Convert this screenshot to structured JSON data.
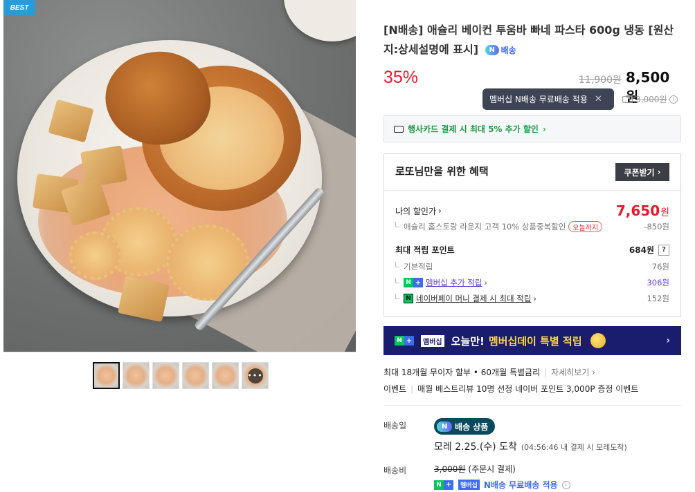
{
  "gallery": {
    "badge": "BEST",
    "thumb_more": "•••"
  },
  "product": {
    "title": "[N배송] 애슐리 베이컨 투움바 빠네 파스타 600g 냉동 [원산지:상세설명에 표시]",
    "npay_delivery_label": "배송",
    "discount_rate": "35%",
    "original_price": "11,900원",
    "sale_price": "8,500원"
  },
  "shipping_tooltip": {
    "text": "멤버십 N배송 무료배송 적용",
    "close": "✕"
  },
  "shipping_fee_row": {
    "fee": "3,000원",
    "info": "i"
  },
  "card_promo": {
    "text": "행사카드 결제 시 최대 5% 추가 할인",
    "arrow": "›"
  },
  "benefit": {
    "header": "로또님만을 위한 혜택",
    "coupon_button": "쿠폰받기",
    "coupon_arrow": "›",
    "my_discount_label": "나의 할인가",
    "my_discount_arrow": "›",
    "my_discount_value": "7,650",
    "my_discount_unit": "원",
    "discount_detail": "애슐리 홈스토랑 라운지 고객 10% 상품중복할인",
    "discount_detail_badge": "오늘까지",
    "discount_detail_value": "-850원",
    "points_label": "최대 적립 포인트",
    "points_value": "684원",
    "points_help": "?",
    "basic_points_label": "기본적립",
    "basic_points_value": "76원",
    "membership_points_label": "멤버십 추가 적립",
    "membership_points_arrow": "›",
    "membership_points_value": "306원",
    "npay_points_label": "네이버페이 머니 결제 시 최대 적립",
    "npay_points_arrow": "›",
    "npay_points_value": "152원"
  },
  "banner": {
    "membership_tag": "멤버십",
    "text_white": "오늘만!",
    "text_yellow": "멤버십데이 특별 적립",
    "arrow": "›"
  },
  "payment_info": {
    "installment": "최대 18개월 무이자 할부 • 60개월 특별금리",
    "separator": "|",
    "more": "자세히보기 ›",
    "event_label": "이벤트",
    "event_text": "매월 베스트리뷰 10명 선정 네이버 포인트 3,000P 증정 이벤트"
  },
  "delivery": {
    "date_label": "배송일",
    "badge": "배송 상품",
    "badge_logo": "N",
    "arrival": "모레 2.25.(수) 도착",
    "arrival_note": "(04:56:46 내 결제 시 모레도착)",
    "fee_label": "배송비",
    "fee_original": "3,000원",
    "fee_note": "(주문시 결제)",
    "membership_tag": "멤버십",
    "free_text": "N배송 무료배송 적용",
    "info": "i"
  },
  "colors": {
    "discount_red": "#e5192e",
    "membership_purple": "#5b3fd6",
    "naver_green": "#03c75a",
    "banner_navy": "#1a1d6e",
    "tooltip_bg": "#3d4453"
  }
}
